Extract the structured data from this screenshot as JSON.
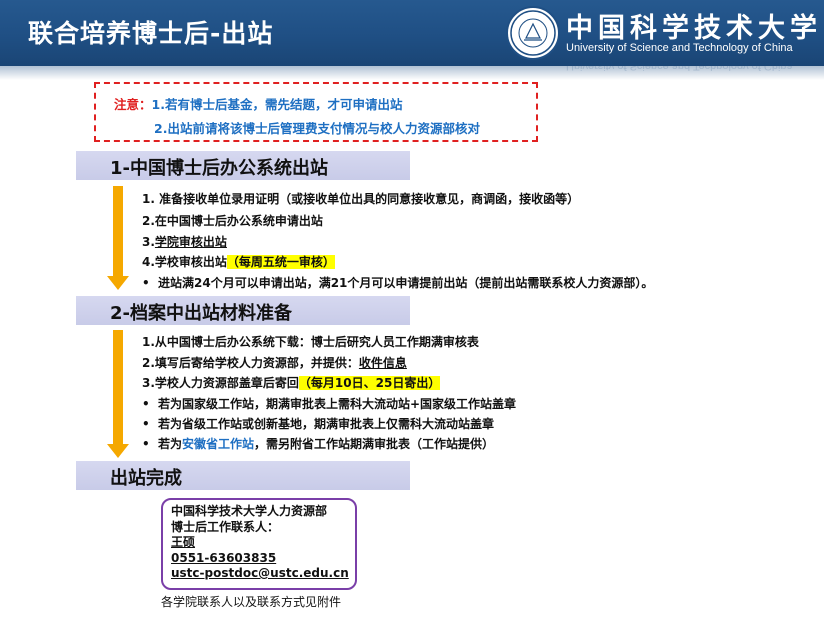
{
  "header": {
    "title": "联合培养博士后-出站",
    "logo_cn": "中国科学技术大学",
    "logo_en": "University of Science and Technology of China"
  },
  "notice": {
    "label": "注意：",
    "line1": "1.若有博士后基金，需先结题，才可申请出站",
    "line2": "2.出站前请将该博士后管理费支付情况与校人力资源部核对"
  },
  "step1": {
    "title": "1-中国博士后办公系统出站",
    "items": [
      "1. 准备接收单位录用证明（或接收单位出具的同意接收意见，商调函，接收函等）",
      "2.在中国博士后办公系统申请出站"
    ],
    "item3_prefix": "3.",
    "item3_link": "学院审核出站",
    "item4_text": "4.学校审核出站",
    "item4_highlight": "（每周五统一审核）",
    "bullet": "进站满24个月可以申请出站，满21个月可以申请提前出站（提前出站需联系校人力资源部）。"
  },
  "step2": {
    "title": "2-档案中出站材料准备",
    "item1": "1.从中国博士后办公系统下载：博士后研究人员工作期满审核表",
    "item2_text": "2.填写后寄给学校人力资源部，并提供：",
    "item2_link": "收件信息",
    "item3_text": "3.学校人力资源部盖章后寄回",
    "item3_highlight": "（每月10日、25日寄出）",
    "bullet1": "若为国家级工作站，期满审批表上需科大流动站+国家级工作站盖章",
    "bullet2": "若为省级工作站或创新基地，期满审批表上仅需科大流动站盖章",
    "bullet3_prefix": "若为",
    "bullet3_blue": "安徽省工作站",
    "bullet3_suffix": "，需另附省工作站期满审批表（工作站提供）"
  },
  "step3": {
    "title": "出站完成"
  },
  "contact": {
    "org": "中国科学技术大学人力资源部",
    "role": "博士后工作联系人：",
    "name": "王硕",
    "phone": "0551-63603835",
    "email": "ustc-postdoc@ustc.edu.cn"
  },
  "contact_note": "各学院联系人以及联系方式见附件",
  "bullet_symbol": "•",
  "colors": {
    "header_blue": "#1f4f84",
    "notice_red": "#e02020",
    "link_blue": "#1e6fc2",
    "arrow_orange": "#f5a800",
    "step_bar": "#cdd0ec",
    "highlight": "#ffff00",
    "contact_border": "#7a3fa8"
  }
}
